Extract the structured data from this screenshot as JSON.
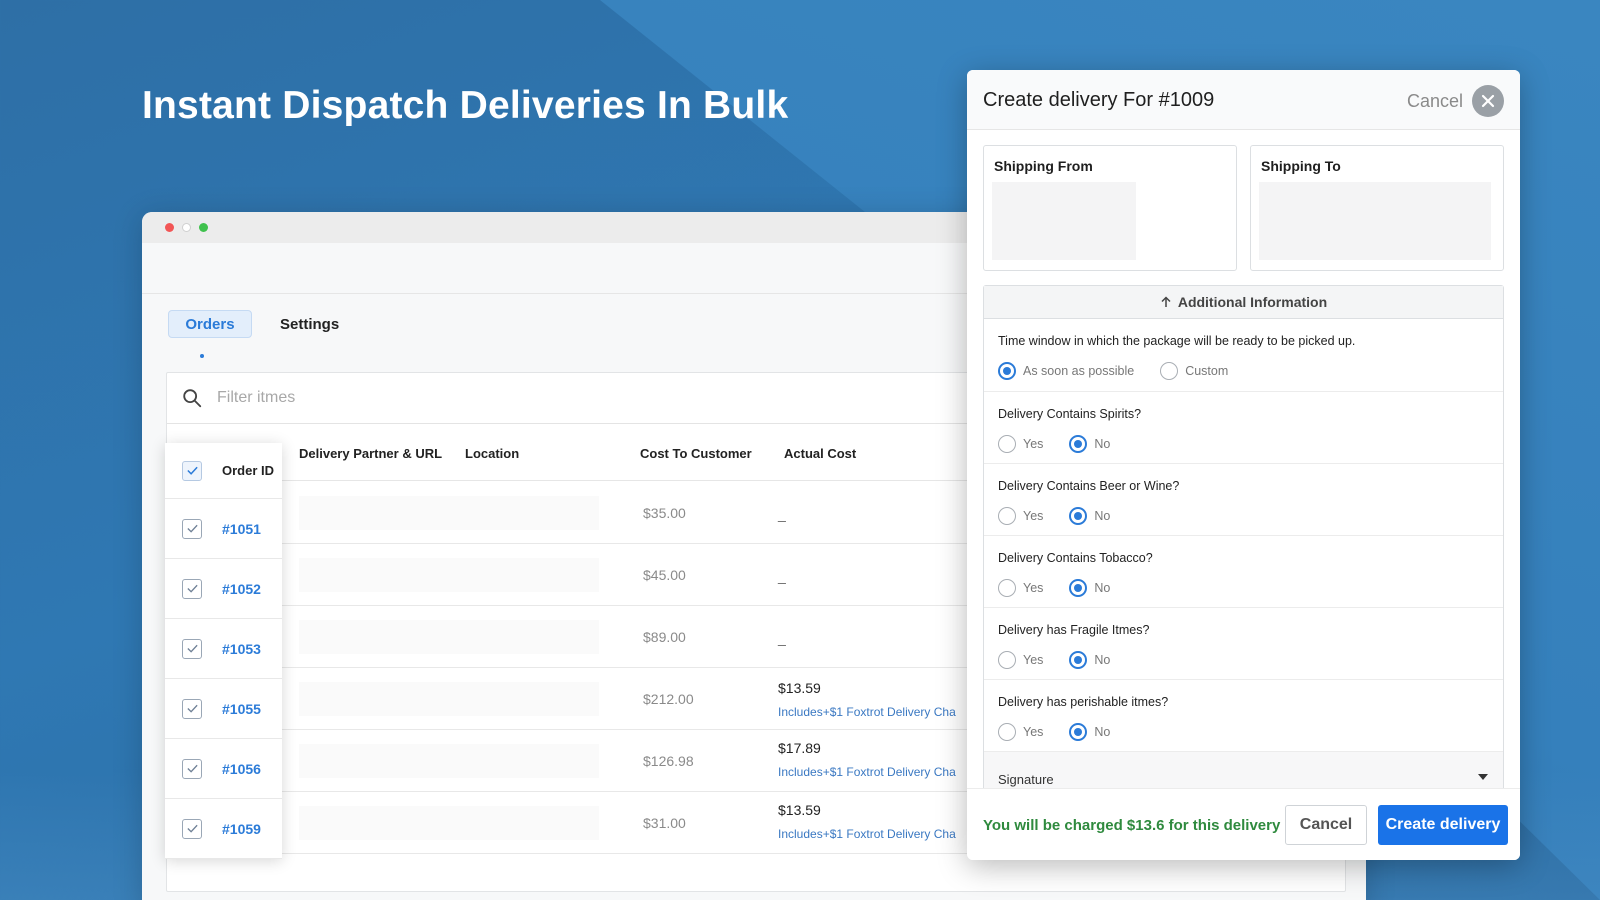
{
  "headline": "Instant Dispatch Deliveries In Bulk",
  "tabs": {
    "orders": "Orders",
    "settings": "Settings"
  },
  "search": {
    "placeholder": "Filter itmes"
  },
  "table": {
    "headers": {
      "order_id": "Order ID",
      "partner": "Delivery Partner & URL",
      "location": "Location",
      "cost_to_customer": "Cost To Customer",
      "actual_cost": "Actual Cost"
    },
    "rows": [
      {
        "id": "#1051",
        "cost": "$35.00",
        "actual": "_",
        "note": ""
      },
      {
        "id": "#1052",
        "cost": "$45.00",
        "actual": "_",
        "note": ""
      },
      {
        "id": "#1053",
        "cost": "$89.00",
        "actual": "_",
        "note": ""
      },
      {
        "id": "#1055",
        "cost": "$212.00",
        "actual": "$13.59",
        "note": "Includes+$1 Foxtrot Delivery Cha"
      },
      {
        "id": "#1056",
        "cost": "$126.98",
        "actual": "$17.89",
        "note": "Includes+$1 Foxtrot Delivery Cha"
      },
      {
        "id": "#1059",
        "cost": "$31.00",
        "actual": "$13.59",
        "note": "Includes+$1 Foxtrot Delivery Cha"
      }
    ]
  },
  "modal": {
    "title": "Create delivery For #1009",
    "cancel_link": "Cancel",
    "shipping_from": "Shipping From",
    "shipping_to": "Shipping To",
    "additional_info": "Additional Information",
    "questions": [
      {
        "text": "Time window in which the package will be ready to be picked up.",
        "options": [
          "As soon as possible",
          "Custom"
        ],
        "selected": 0
      },
      {
        "text": "Delivery Contains Spirits?",
        "options": [
          "Yes",
          "No"
        ],
        "selected": 1
      },
      {
        "text": "Delivery Contains Beer or Wine?",
        "options": [
          "Yes",
          "No"
        ],
        "selected": 1
      },
      {
        "text": "Delivery Contains Tobacco?",
        "options": [
          "Yes",
          "No"
        ],
        "selected": 1
      },
      {
        "text": "Delivery has Fragile Itmes?",
        "options": [
          "Yes",
          "No"
        ],
        "selected": 1
      },
      {
        "text": "Delivery has perishable itmes?",
        "options": [
          "Yes",
          "No"
        ],
        "selected": 1
      }
    ],
    "signature_label": "Signature",
    "charge_text": "You will be charged $13.6 for this delivery",
    "cancel_button": "Cancel",
    "create_button": "Create delivery"
  },
  "colors": {
    "accent": "#1a73e8",
    "link": "#2b7bd8",
    "success": "#2f8a3e"
  }
}
